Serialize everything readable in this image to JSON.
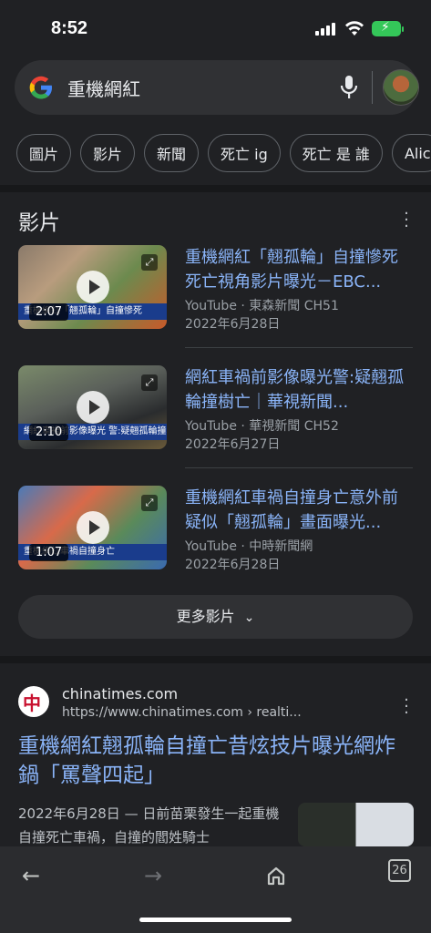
{
  "status": {
    "time": "8:52"
  },
  "search": {
    "query": "重機網紅"
  },
  "chips": [
    "圖片",
    "影片",
    "新聞",
    "死亡 ig",
    "死亡 是 誰",
    "Alic"
  ],
  "videos_section": {
    "title": "影片",
    "items": [
      {
        "title": "重機網紅「翹孤輪」自撞慘死死亡視角影片曝光－EBC...",
        "source": "YouTube · 東森新聞 CH51",
        "date": "2022年6月28日",
        "duration": "2:07",
        "caption": "重機網紅「翹孤輪」自撞慘死"
      },
      {
        "title": "網紅車禍前影像曝光警:疑翹孤輪撞樹亡｜華視新聞...",
        "source": "YouTube · 華視新聞 CH52",
        "date": "2022年6月27日",
        "duration": "2:10",
        "caption": "網紅車禍前影像曝光 警:疑翹孤輪撞樹亡"
      },
      {
        "title": "重機網紅車禍自撞身亡意外前疑似「翹孤輪」畫面曝光...",
        "source": "YouTube · 中時新聞網",
        "date": "2022年6月28日",
        "duration": "1:07",
        "caption": "重機網紅車禍自撞身亡"
      }
    ],
    "more_label": "更多影片"
  },
  "result": {
    "site_name": "chinatimes.com",
    "url": "https://www.chinatimes.com › realti...",
    "title": "重機網紅翹孤輪自撞亡昔炫技片曝光網炸鍋「罵聲四起」",
    "snippet": "2022年6月28日 — 日前苗栗發生一起重機自撞死亡車禍，自撞的閻姓騎士",
    "icon_char": "中"
  },
  "toolbar": {
    "tab_count": "26"
  }
}
